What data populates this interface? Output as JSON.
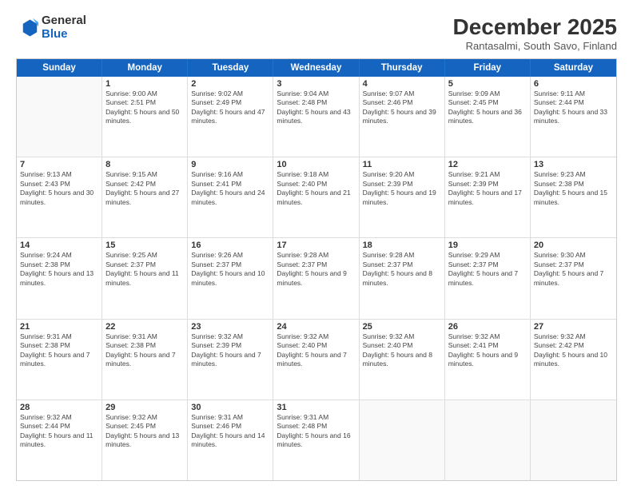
{
  "logo": {
    "line1": "General",
    "line2": "Blue"
  },
  "title": "December 2025",
  "subtitle": "Rantasalmi, South Savo, Finland",
  "headers": [
    "Sunday",
    "Monday",
    "Tuesday",
    "Wednesday",
    "Thursday",
    "Friday",
    "Saturday"
  ],
  "weeks": [
    [
      {
        "day": "",
        "sunrise": "",
        "sunset": "",
        "daylight": ""
      },
      {
        "day": "1",
        "sunrise": "Sunrise: 9:00 AM",
        "sunset": "Sunset: 2:51 PM",
        "daylight": "Daylight: 5 hours and 50 minutes."
      },
      {
        "day": "2",
        "sunrise": "Sunrise: 9:02 AM",
        "sunset": "Sunset: 2:49 PM",
        "daylight": "Daylight: 5 hours and 47 minutes."
      },
      {
        "day": "3",
        "sunrise": "Sunrise: 9:04 AM",
        "sunset": "Sunset: 2:48 PM",
        "daylight": "Daylight: 5 hours and 43 minutes."
      },
      {
        "day": "4",
        "sunrise": "Sunrise: 9:07 AM",
        "sunset": "Sunset: 2:46 PM",
        "daylight": "Daylight: 5 hours and 39 minutes."
      },
      {
        "day": "5",
        "sunrise": "Sunrise: 9:09 AM",
        "sunset": "Sunset: 2:45 PM",
        "daylight": "Daylight: 5 hours and 36 minutes."
      },
      {
        "day": "6",
        "sunrise": "Sunrise: 9:11 AM",
        "sunset": "Sunset: 2:44 PM",
        "daylight": "Daylight: 5 hours and 33 minutes."
      }
    ],
    [
      {
        "day": "7",
        "sunrise": "Sunrise: 9:13 AM",
        "sunset": "Sunset: 2:43 PM",
        "daylight": "Daylight: 5 hours and 30 minutes."
      },
      {
        "day": "8",
        "sunrise": "Sunrise: 9:15 AM",
        "sunset": "Sunset: 2:42 PM",
        "daylight": "Daylight: 5 hours and 27 minutes."
      },
      {
        "day": "9",
        "sunrise": "Sunrise: 9:16 AM",
        "sunset": "Sunset: 2:41 PM",
        "daylight": "Daylight: 5 hours and 24 minutes."
      },
      {
        "day": "10",
        "sunrise": "Sunrise: 9:18 AM",
        "sunset": "Sunset: 2:40 PM",
        "daylight": "Daylight: 5 hours and 21 minutes."
      },
      {
        "day": "11",
        "sunrise": "Sunrise: 9:20 AM",
        "sunset": "Sunset: 2:39 PM",
        "daylight": "Daylight: 5 hours and 19 minutes."
      },
      {
        "day": "12",
        "sunrise": "Sunrise: 9:21 AM",
        "sunset": "Sunset: 2:39 PM",
        "daylight": "Daylight: 5 hours and 17 minutes."
      },
      {
        "day": "13",
        "sunrise": "Sunrise: 9:23 AM",
        "sunset": "Sunset: 2:38 PM",
        "daylight": "Daylight: 5 hours and 15 minutes."
      }
    ],
    [
      {
        "day": "14",
        "sunrise": "Sunrise: 9:24 AM",
        "sunset": "Sunset: 2:38 PM",
        "daylight": "Daylight: 5 hours and 13 minutes."
      },
      {
        "day": "15",
        "sunrise": "Sunrise: 9:25 AM",
        "sunset": "Sunset: 2:37 PM",
        "daylight": "Daylight: 5 hours and 11 minutes."
      },
      {
        "day": "16",
        "sunrise": "Sunrise: 9:26 AM",
        "sunset": "Sunset: 2:37 PM",
        "daylight": "Daylight: 5 hours and 10 minutes."
      },
      {
        "day": "17",
        "sunrise": "Sunrise: 9:28 AM",
        "sunset": "Sunset: 2:37 PM",
        "daylight": "Daylight: 5 hours and 9 minutes."
      },
      {
        "day": "18",
        "sunrise": "Sunrise: 9:28 AM",
        "sunset": "Sunset: 2:37 PM",
        "daylight": "Daylight: 5 hours and 8 minutes."
      },
      {
        "day": "19",
        "sunrise": "Sunrise: 9:29 AM",
        "sunset": "Sunset: 2:37 PM",
        "daylight": "Daylight: 5 hours and 7 minutes."
      },
      {
        "day": "20",
        "sunrise": "Sunrise: 9:30 AM",
        "sunset": "Sunset: 2:37 PM",
        "daylight": "Daylight: 5 hours and 7 minutes."
      }
    ],
    [
      {
        "day": "21",
        "sunrise": "Sunrise: 9:31 AM",
        "sunset": "Sunset: 2:38 PM",
        "daylight": "Daylight: 5 hours and 7 minutes."
      },
      {
        "day": "22",
        "sunrise": "Sunrise: 9:31 AM",
        "sunset": "Sunset: 2:38 PM",
        "daylight": "Daylight: 5 hours and 7 minutes."
      },
      {
        "day": "23",
        "sunrise": "Sunrise: 9:32 AM",
        "sunset": "Sunset: 2:39 PM",
        "daylight": "Daylight: 5 hours and 7 minutes."
      },
      {
        "day": "24",
        "sunrise": "Sunrise: 9:32 AM",
        "sunset": "Sunset: 2:40 PM",
        "daylight": "Daylight: 5 hours and 7 minutes."
      },
      {
        "day": "25",
        "sunrise": "Sunrise: 9:32 AM",
        "sunset": "Sunset: 2:40 PM",
        "daylight": "Daylight: 5 hours and 8 minutes."
      },
      {
        "day": "26",
        "sunrise": "Sunrise: 9:32 AM",
        "sunset": "Sunset: 2:41 PM",
        "daylight": "Daylight: 5 hours and 9 minutes."
      },
      {
        "day": "27",
        "sunrise": "Sunrise: 9:32 AM",
        "sunset": "Sunset: 2:42 PM",
        "daylight": "Daylight: 5 hours and 10 minutes."
      }
    ],
    [
      {
        "day": "28",
        "sunrise": "Sunrise: 9:32 AM",
        "sunset": "Sunset: 2:44 PM",
        "daylight": "Daylight: 5 hours and 11 minutes."
      },
      {
        "day": "29",
        "sunrise": "Sunrise: 9:32 AM",
        "sunset": "Sunset: 2:45 PM",
        "daylight": "Daylight: 5 hours and 13 minutes."
      },
      {
        "day": "30",
        "sunrise": "Sunrise: 9:31 AM",
        "sunset": "Sunset: 2:46 PM",
        "daylight": "Daylight: 5 hours and 14 minutes."
      },
      {
        "day": "31",
        "sunrise": "Sunrise: 9:31 AM",
        "sunset": "Sunset: 2:48 PM",
        "daylight": "Daylight: 5 hours and 16 minutes."
      },
      {
        "day": "",
        "sunrise": "",
        "sunset": "",
        "daylight": ""
      },
      {
        "day": "",
        "sunrise": "",
        "sunset": "",
        "daylight": ""
      },
      {
        "day": "",
        "sunrise": "",
        "sunset": "",
        "daylight": ""
      }
    ]
  ]
}
